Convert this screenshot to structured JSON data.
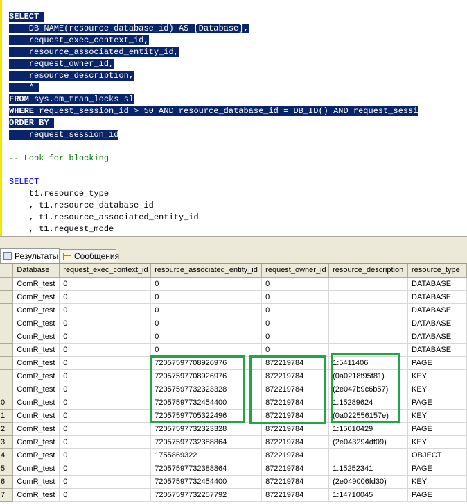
{
  "editor": {
    "lines": [
      {
        "style": "sel",
        "kw": "SELECT",
        "text": " "
      },
      {
        "style": "sel",
        "kw": "",
        "text": "    DB_NAME(resource_database_id) AS [Database],"
      },
      {
        "style": "sel",
        "kw": "",
        "text": "    request_exec_context_id,"
      },
      {
        "style": "sel",
        "kw": "",
        "text": "    resource_associated_entity_id,"
      },
      {
        "style": "sel",
        "kw": "",
        "text": "    request_owner_id,"
      },
      {
        "style": "sel",
        "kw": "",
        "text": "    resource_description,"
      },
      {
        "style": "sel",
        "kw": "",
        "text": "    * "
      },
      {
        "style": "sel",
        "kw": "FROM",
        "text": " sys.dm_tran_locks sl"
      },
      {
        "style": "sel",
        "kw": "WHERE",
        "text": " request_session_id > 50 AND resource_database_id = DB_ID() AND request_sessi"
      },
      {
        "style": "sel",
        "kw": "ORDER BY",
        "text": " "
      },
      {
        "style": "sel",
        "kw": "",
        "text": "    request_session_id"
      },
      {
        "style": "plain",
        "kw": "",
        "text": ""
      },
      {
        "style": "comment",
        "kw": "",
        "text": "-- Look for blocking"
      },
      {
        "style": "plain",
        "kw": "",
        "text": ""
      },
      {
        "style": "plain",
        "kw": "SELECT",
        "text": ""
      },
      {
        "style": "plain",
        "kw": "",
        "text": "    t1.resource_type"
      },
      {
        "style": "plain",
        "kw": "",
        "text": "    , t1.resource_database_id"
      },
      {
        "style": "plain",
        "kw": "",
        "text": "    , t1.resource_associated_entity_id"
      },
      {
        "style": "plain",
        "kw": "",
        "text": "    , t1.request_mode"
      }
    ]
  },
  "tabs": [
    {
      "label": "Результаты",
      "icon": "grid-icon"
    },
    {
      "label": "Сообщения",
      "icon": "messages-icon"
    }
  ],
  "grid": {
    "columns": [
      "Database",
      "request_exec_context_id",
      "resource_associated_entity_id",
      "request_owner_id",
      "resource_description",
      "resource_type"
    ],
    "rows": [
      {
        "num": "",
        "cells": [
          "ComR_test",
          "0",
          "0",
          "0",
          "",
          "DATABASE"
        ]
      },
      {
        "num": "",
        "cells": [
          "ComR_test",
          "0",
          "0",
          "0",
          "",
          "DATABASE"
        ]
      },
      {
        "num": "",
        "cells": [
          "ComR_test",
          "0",
          "0",
          "0",
          "",
          "DATABASE"
        ]
      },
      {
        "num": "",
        "cells": [
          "ComR_test",
          "0",
          "0",
          "0",
          "",
          "DATABASE"
        ]
      },
      {
        "num": "",
        "cells": [
          "ComR_test",
          "0",
          "0",
          "0",
          "",
          "DATABASE"
        ]
      },
      {
        "num": "",
        "cells": [
          "ComR_test",
          "0",
          "0",
          "0",
          "",
          "DATABASE"
        ]
      },
      {
        "num": "",
        "cells": [
          "ComR_test",
          "0",
          "72057597708926976",
          "872219784",
          "1:5411406",
          "PAGE"
        ]
      },
      {
        "num": "",
        "cells": [
          "ComR_test",
          "0",
          "72057597708926976",
          "872219784",
          "(0a0218f95f81)",
          "KEY"
        ]
      },
      {
        "num": "",
        "cells": [
          "ComR_test",
          "0",
          "72057597732323328",
          "872219784",
          "(2e047b9c6b57)",
          "KEY"
        ]
      },
      {
        "num": "0",
        "cells": [
          "ComR_test",
          "0",
          "72057597732454400",
          "872219784",
          "1:15289624",
          "PAGE"
        ]
      },
      {
        "num": "1",
        "cells": [
          "ComR_test",
          "0",
          "72057597705322496",
          "872219784",
          "(0a022556157e)",
          "KEY"
        ]
      },
      {
        "num": "2",
        "cells": [
          "ComR_test",
          "0",
          "72057597732323328",
          "872219784",
          "1:15010429",
          "PAGE"
        ]
      },
      {
        "num": "3",
        "cells": [
          "ComR_test",
          "0",
          "72057597732388864",
          "872219784",
          "(2e043294df09)",
          "KEY"
        ]
      },
      {
        "num": "4",
        "cells": [
          "ComR_test",
          "0",
          "1755869322",
          "872219784",
          "",
          "OBJECT"
        ]
      },
      {
        "num": "5",
        "cells": [
          "ComR_test",
          "0",
          "72057597732388864",
          "872219784",
          "1:15252341",
          "PAGE"
        ]
      },
      {
        "num": "6",
        "cells": [
          "ComR_test",
          "0",
          "72057597732454400",
          "872219784",
          "(2e049006fd30)",
          "KEY"
        ]
      },
      {
        "num": "7",
        "cells": [
          "ComR_test",
          "0",
          "72057597732257792",
          "872219784",
          "1:14710045",
          "PAGE"
        ]
      }
    ]
  }
}
